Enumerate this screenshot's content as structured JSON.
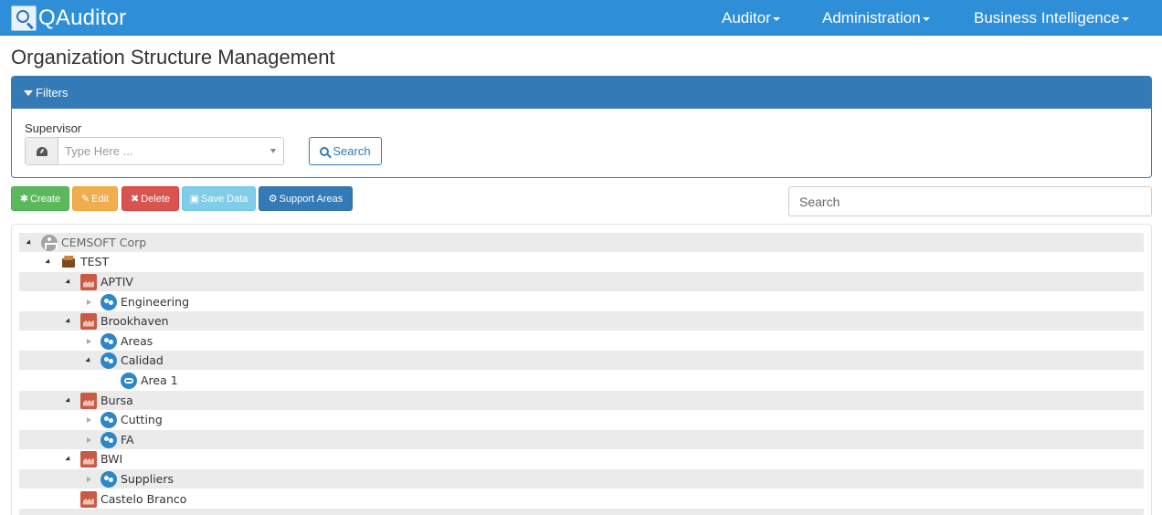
{
  "navbar": {
    "brand": "QAuditor",
    "menus": [
      {
        "label": "Auditor"
      },
      {
        "label": "Administration"
      },
      {
        "label": "Business Intelligence"
      }
    ],
    "color": "#2e8fd8"
  },
  "page": {
    "title": "Organization Structure Management"
  },
  "filters": {
    "heading": "Filters",
    "supervisor_label": "Supervisor",
    "supervisor_placeholder": "Type Here ...",
    "search_button": "Search"
  },
  "actions": {
    "create": "Create",
    "edit": "Edit",
    "delete": "Delete",
    "save": "Save Data",
    "support": "Support Areas"
  },
  "tree_search": {
    "placeholder": "Search"
  },
  "tree": [
    {
      "label": "CEMSOFT Corp",
      "icon": "corp-icon",
      "toggle": "open"
    },
    {
      "label": "TEST",
      "icon": "test-folder-icon",
      "toggle": "open"
    },
    {
      "label": "APTIV",
      "icon": "plant-icon",
      "toggle": "open"
    },
    {
      "label": "Engineering",
      "icon": "area-icon",
      "toggle": "closed"
    },
    {
      "label": "Brookhaven",
      "icon": "plant-icon",
      "toggle": "open"
    },
    {
      "label": "Areas",
      "icon": "area-icon",
      "toggle": "closed"
    },
    {
      "label": "Calidad",
      "icon": "area-icon",
      "toggle": "open"
    },
    {
      "label": "Area 1",
      "icon": "subarea-icon",
      "toggle": "none"
    },
    {
      "label": "Bursa",
      "icon": "plant-icon",
      "toggle": "open"
    },
    {
      "label": "Cutting",
      "icon": "area-icon",
      "toggle": "closed"
    },
    {
      "label": "FA",
      "icon": "area-icon",
      "toggle": "closed"
    },
    {
      "label": "BWI",
      "icon": "plant-icon",
      "toggle": "open"
    },
    {
      "label": "Suppliers",
      "icon": "area-icon",
      "toggle": "closed"
    },
    {
      "label": "Castelo Branco",
      "icon": "plant-icon",
      "toggle": "none"
    }
  ]
}
